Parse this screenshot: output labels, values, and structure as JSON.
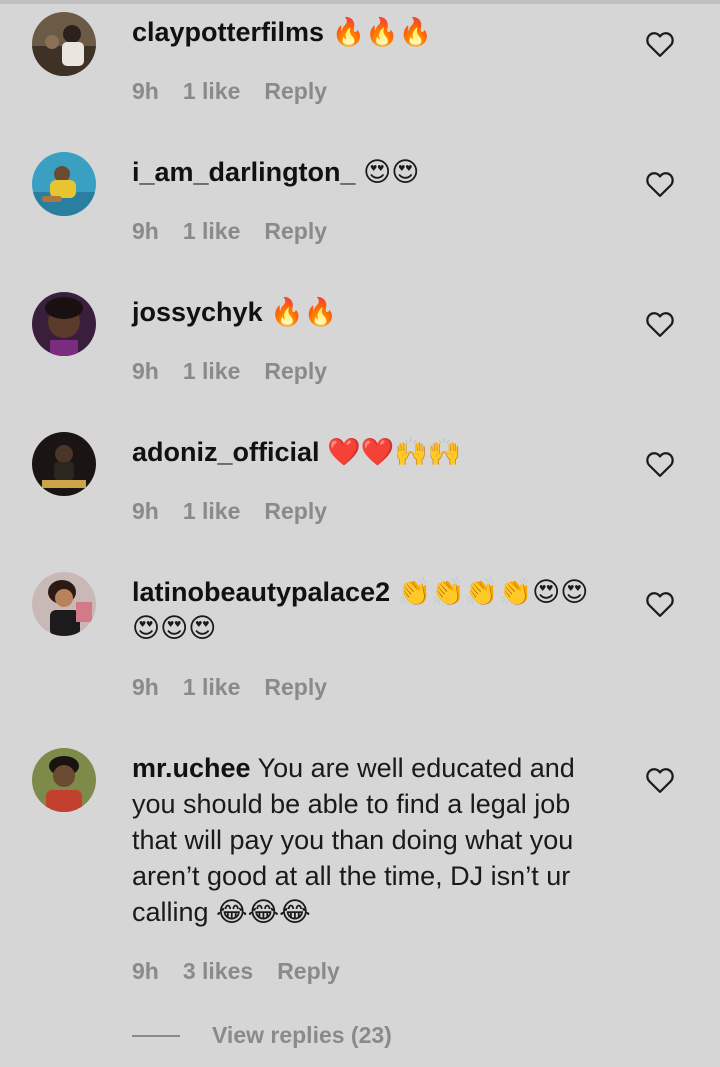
{
  "comments": [
    {
      "username": "claypotterfilms",
      "text": " 🔥🔥🔥",
      "time": "9h",
      "likes": "1 like",
      "reply": "Reply",
      "avatar": "avatar-photo"
    },
    {
      "username": "i_am_darlington_",
      "text": " 😍😍",
      "time": "9h",
      "likes": "1 like",
      "reply": "Reply",
      "avatar": "avatar-photo"
    },
    {
      "username": "jossychyk",
      "text": " 🔥🔥",
      "time": "9h",
      "likes": "1 like",
      "reply": "Reply",
      "avatar": "avatar-photo"
    },
    {
      "username": "adoniz_official",
      "text": " ❤️❤️🙌🙌",
      "time": "9h",
      "likes": "1 like",
      "reply": "Reply",
      "avatar": "avatar-photo"
    },
    {
      "username": "latinobeautypalace2",
      "text": " 👏👏👏👏😍😍😍😍😍",
      "time": "9h",
      "likes": "1 like",
      "reply": "Reply",
      "avatar": "avatar-photo"
    },
    {
      "username": "mr.uchee",
      "text": " You are well educated and you should be able to find a legal job that will pay you than doing what you aren’t good at all the time, DJ isn’t ur calling 😂😂😂",
      "time": "9h",
      "likes": "3 likes",
      "reply": "Reply",
      "avatar": "avatar-photo"
    }
  ],
  "view_replies": "View replies (23)",
  "colors": {
    "background": "#d6d6d6",
    "meta_text": "#8a8a8a",
    "username": "#111111"
  },
  "icons": {
    "like": "heart-outline-icon"
  }
}
